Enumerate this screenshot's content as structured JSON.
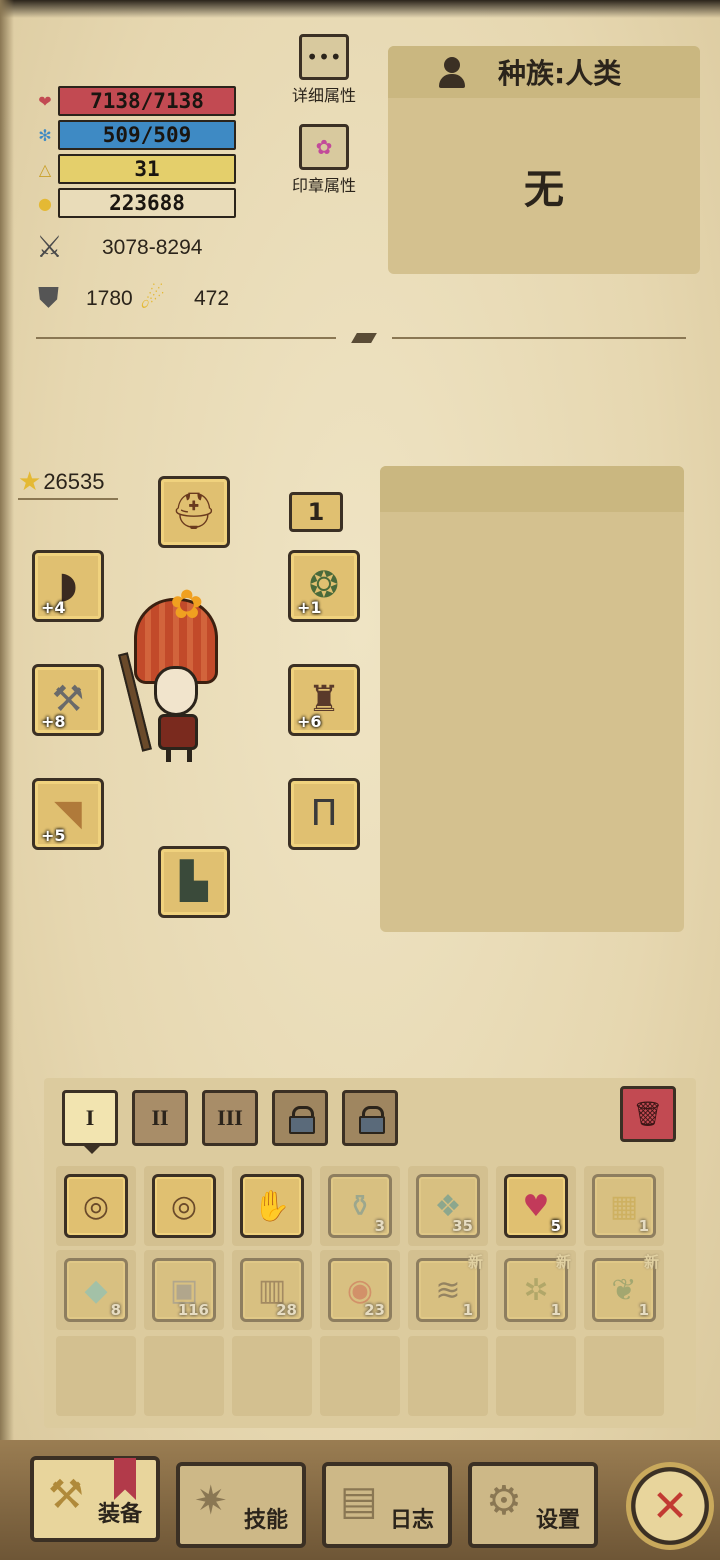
{
  "stats": {
    "hp": {
      "text": "7138/7138",
      "fill": 1.0,
      "color": "#c24a52",
      "icon": "heart-icon"
    },
    "mp": {
      "text": "509/509",
      "fill": 1.0,
      "color": "#3e8ac4",
      "icon": "gear-icon"
    },
    "level": {
      "text": "31",
      "fill": 1.0,
      "color": "#e4cf6b",
      "icon": "triangle-icon"
    },
    "gold": {
      "text": "223688",
      "icon": "gold-icon"
    },
    "attack": "3078-8294",
    "defense": "1780",
    "magic": "472"
  },
  "attributes": {
    "detail_label": "详细属性",
    "seal_label": "印章属性"
  },
  "race": {
    "label": "种族:人类",
    "value": "无"
  },
  "equipment": {
    "score": "26535",
    "level_tag": "1",
    "slots": {
      "shoulder": {
        "icon": "shoulder-armor-icon",
        "plus": "+4"
      },
      "weapon": {
        "icon": "axe-icon",
        "plus": "+8"
      },
      "offhand": {
        "icon": "horn-icon",
        "plus": "+5"
      },
      "helmet": {
        "icon": "helmet-icon",
        "plus": ""
      },
      "amulet": {
        "icon": "amulet-icon",
        "plus": "+1"
      },
      "armor": {
        "icon": "chest-armor-icon",
        "plus": "+6"
      },
      "pants": {
        "icon": "pants-icon",
        "plus": ""
      },
      "boots": {
        "icon": "boots-icon",
        "plus": ""
      }
    }
  },
  "inventory": {
    "tabs": [
      "I",
      "II",
      "III"
    ],
    "row1": [
      {
        "icon": "ring-icon",
        "count": "",
        "dim": false
      },
      {
        "icon": "ring-icon",
        "count": "",
        "dim": false
      },
      {
        "icon": "gauntlet-icon",
        "count": "",
        "dim": false
      },
      {
        "icon": "potion-icon",
        "count": "3",
        "dim": true
      },
      {
        "icon": "scroll-icon",
        "count": "35",
        "dim": true
      },
      {
        "icon": "red-potion-icon",
        "count": "5",
        "dim": false
      },
      {
        "icon": "map-icon",
        "count": "1",
        "dim": true
      }
    ],
    "row2": [
      {
        "icon": "crystal-icon",
        "count": "8",
        "new": ""
      },
      {
        "icon": "stone-icon",
        "count": "116",
        "new": ""
      },
      {
        "icon": "chest-icon",
        "count": "28",
        "new": ""
      },
      {
        "icon": "meat-icon",
        "count": "23",
        "new": ""
      },
      {
        "icon": "fur-icon",
        "count": "1",
        "new": "新"
      },
      {
        "icon": "herb-icon",
        "count": "1",
        "new": "新"
      },
      {
        "icon": "leaf-icon",
        "count": "1",
        "new": "新"
      }
    ]
  },
  "nav": {
    "equip": "装备",
    "skills": "技能",
    "log": "日志",
    "settings": "设置"
  }
}
